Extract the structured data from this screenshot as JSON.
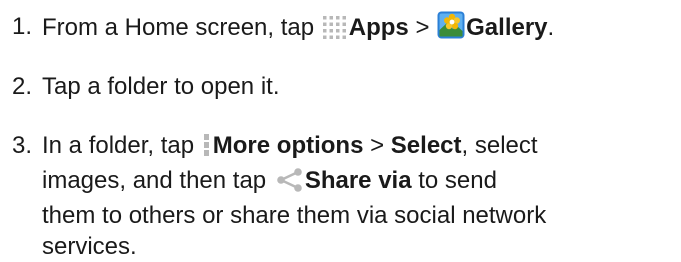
{
  "steps": [
    {
      "number": "1.",
      "text_a": "From a Home screen, tap",
      "apps_icon": "apps-grid-icon",
      "apps_label": "Apps",
      "separator": ">",
      "gallery_icon": "gallery-app-icon",
      "gallery_label": "Gallery",
      "end": "."
    },
    {
      "number": "2.",
      "text": "Tap a folder to open it."
    },
    {
      "number": "3.",
      "line1_a": "In a folder, tap",
      "more_icon": "more-options-icon",
      "more_label": "More options",
      "separator": ">",
      "select_label": "Select",
      "line1_b": ", select",
      "line2_a": "images, and then tap",
      "share_icon": "share-icon",
      "share_label": "Share via",
      "line2_b": "to send",
      "line3": "them to others or share them via social network",
      "line4": "services."
    }
  ],
  "colors": {
    "text": "#1a1a1a",
    "icon_gray": "#b8b8b8",
    "gallery_blue": "#2b7fd6",
    "gallery_yellow": "#f2b705"
  }
}
